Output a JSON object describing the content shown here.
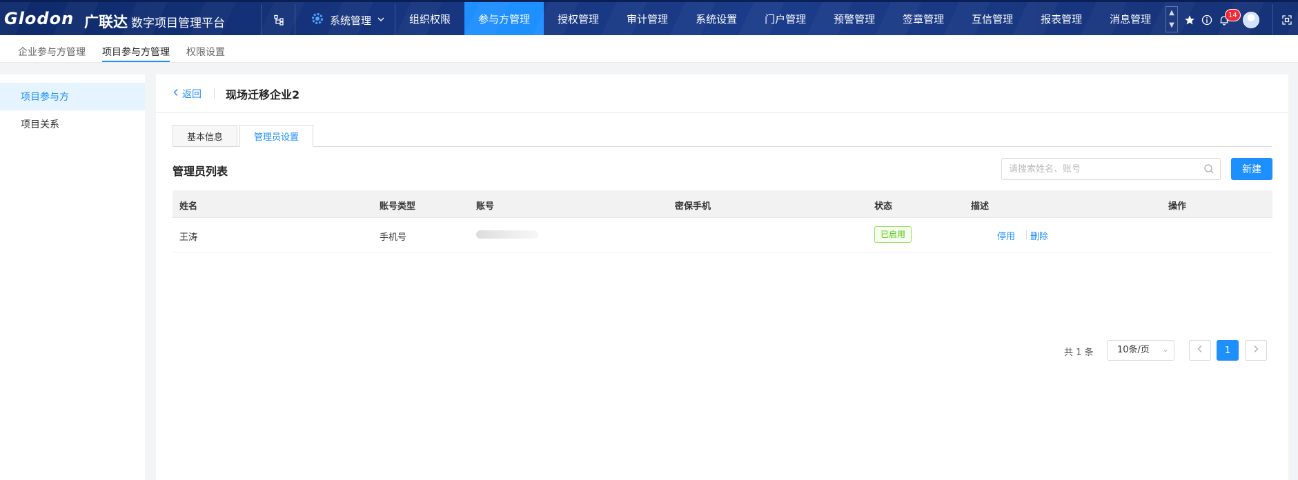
{
  "topbar": {
    "logo": "Glodon",
    "logo_cn": "广联达",
    "platform": "数字项目管理平台",
    "system_menu": "系统管理",
    "nav": [
      {
        "label": "组织权限"
      },
      {
        "label": "参与方管理",
        "active": true
      },
      {
        "label": "授权管理"
      },
      {
        "label": "审计管理"
      },
      {
        "label": "系统设置"
      },
      {
        "label": "门户管理"
      },
      {
        "label": "预警管理"
      },
      {
        "label": "签章管理"
      },
      {
        "label": "互信管理"
      },
      {
        "label": "报表管理"
      },
      {
        "label": "消息管理"
      }
    ],
    "notification_count": "14",
    "icons": [
      "org-tree-icon",
      "gear-icon",
      "star-icon",
      "info-icon",
      "bell-icon",
      "fullscreen-icon"
    ]
  },
  "subnav": {
    "items": [
      "企业参与方管理",
      "项目参与方管理",
      "权限设置"
    ],
    "active_index": 1
  },
  "sidebar": {
    "items": [
      "项目参与方",
      "项目关系"
    ],
    "active_index": 0
  },
  "panel": {
    "back_label": "返回",
    "title": "现场迁移企业2",
    "tabs": [
      "基本信息",
      "管理员设置"
    ],
    "active_tab": 1,
    "section_title": "管理员列表",
    "search_placeholder": "请搜索姓名、账号",
    "new_button": "新建",
    "table": {
      "columns": [
        "姓名",
        "账号类型",
        "账号",
        "密保手机",
        "状态",
        "描述",
        "操作"
      ],
      "rows": [
        {
          "name": "王涛",
          "account_type": "手机号",
          "account": "",
          "security_phone": "",
          "status": "已启用",
          "description": "",
          "actions": [
            "停用",
            "删除"
          ]
        }
      ]
    },
    "pagination": {
      "total_label": "共 1 条",
      "page_size": "10条/页",
      "current_page": "1"
    }
  },
  "colors": {
    "accent": "#1e8fff",
    "topbar": "#17357e",
    "status_green": "#52c41a",
    "badge_red": "#f5222d"
  }
}
